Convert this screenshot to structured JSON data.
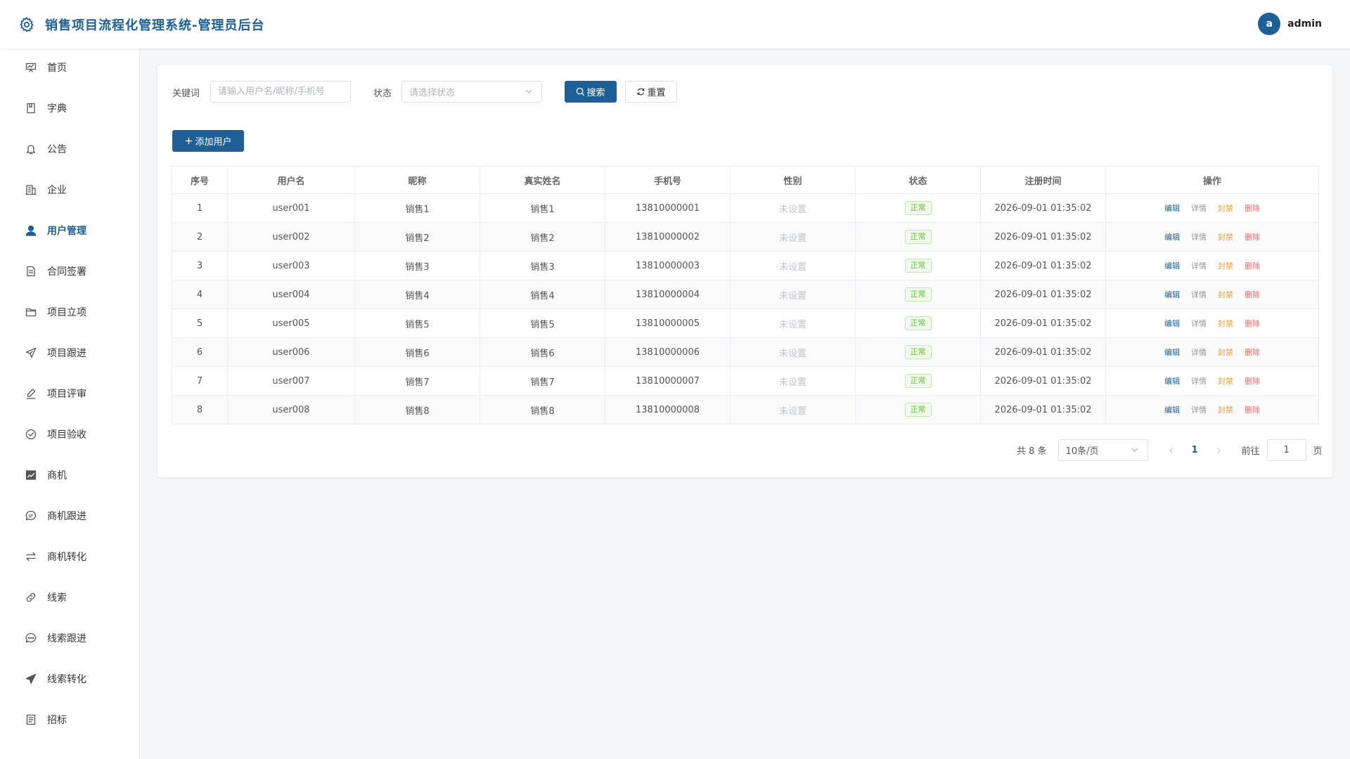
{
  "header": {
    "title": "销售项目流程化管理系统-管理员后台",
    "avatar_letter": "a",
    "username": "admin"
  },
  "sidebar": {
    "items": [
      {
        "label": "首页",
        "icon": "dashboard-icon"
      },
      {
        "label": "字典",
        "icon": "book-icon"
      },
      {
        "label": "公告",
        "icon": "bell-icon"
      },
      {
        "label": "企业",
        "icon": "building-icon"
      },
      {
        "label": "用户管理",
        "icon": "user-icon",
        "active": true
      },
      {
        "label": "合同签署",
        "icon": "document-icon"
      },
      {
        "label": "项目立项",
        "icon": "folder-icon"
      },
      {
        "label": "项目跟进",
        "icon": "send-icon"
      },
      {
        "label": "项目评审",
        "icon": "edit-pen-icon"
      },
      {
        "label": "项目验收",
        "icon": "check-circle-icon"
      },
      {
        "label": "商机",
        "icon": "trend-chart-icon"
      },
      {
        "label": "商机跟进",
        "icon": "chat-round-icon"
      },
      {
        "label": "商机转化",
        "icon": "switch-icon"
      },
      {
        "label": "线索",
        "icon": "link-icon"
      },
      {
        "label": "线索跟进",
        "icon": "chat-dots-icon"
      },
      {
        "label": "线索转化",
        "icon": "promotion-icon"
      },
      {
        "label": "招标",
        "icon": "tickets-icon"
      }
    ]
  },
  "filters": {
    "keyword_label": "关键词",
    "keyword_placeholder": "请输入用户名/昵称/手机号",
    "status_label": "状态",
    "status_placeholder": "请选择状态",
    "search_label": "搜索",
    "reset_label": "重置"
  },
  "toolbar": {
    "add_label": "添加用户"
  },
  "table": {
    "columns": [
      "序号",
      "用户名",
      "昵称",
      "真实姓名",
      "手机号",
      "性别",
      "状态",
      "注册时间",
      "操作"
    ],
    "rows": [
      [
        "1",
        "user001",
        "销售1",
        "销售1",
        "13810000001",
        "未设置",
        "正常",
        "2026-09-01 01:35:02"
      ],
      [
        "2",
        "user002",
        "销售2",
        "销售2",
        "13810000002",
        "未设置",
        "正常",
        "2026-09-01 01:35:02"
      ],
      [
        "3",
        "user003",
        "销售3",
        "销售3",
        "13810000003",
        "未设置",
        "正常",
        "2026-09-01 01:35:02"
      ],
      [
        "4",
        "user004",
        "销售4",
        "销售4",
        "13810000004",
        "未设置",
        "正常",
        "2026-09-01 01:35:02"
      ],
      [
        "5",
        "user005",
        "销售5",
        "销售5",
        "13810000005",
        "未设置",
        "正常",
        "2026-09-01 01:35:02"
      ],
      [
        "6",
        "user006",
        "销售6",
        "销售6",
        "13810000006",
        "未设置",
        "正常",
        "2026-09-01 01:35:02"
      ],
      [
        "7",
        "user007",
        "销售7",
        "销售7",
        "13810000007",
        "未设置",
        "正常",
        "2026-09-01 01:35:02"
      ],
      [
        "8",
        "user008",
        "销售8",
        "销售8",
        "13810000008",
        "未设置",
        "正常",
        "2026-09-01 01:35:02"
      ]
    ],
    "actions": [
      "编辑",
      "详情",
      "封禁",
      "删除"
    ]
  },
  "pagination": {
    "total_text": "共 8 条",
    "page_size": "10条/页",
    "current_page": "1",
    "goto_label": "前往",
    "goto_value": "1",
    "page_suffix": "页"
  },
  "colors": {
    "primary": "#1d5f96",
    "success": "#67c23a",
    "warning": "#e6a23c",
    "danger": "#f56c6c"
  }
}
